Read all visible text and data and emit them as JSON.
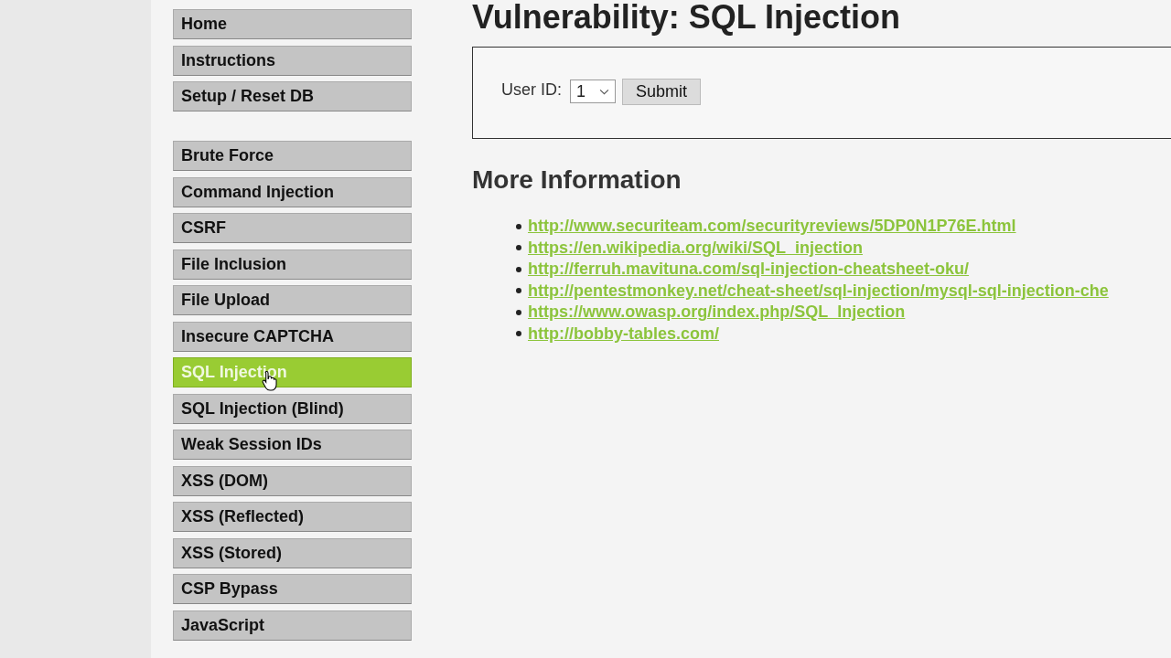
{
  "menu": {
    "groups": [
      {
        "items": [
          {
            "label": "Home",
            "selected": false
          },
          {
            "label": "Instructions",
            "selected": false
          },
          {
            "label": "Setup / Reset DB",
            "selected": false
          }
        ]
      },
      {
        "items": [
          {
            "label": "Brute Force",
            "selected": false
          },
          {
            "label": "Command Injection",
            "selected": false
          },
          {
            "label": "CSRF",
            "selected": false
          },
          {
            "label": "File Inclusion",
            "selected": false
          },
          {
            "label": "File Upload",
            "selected": false
          },
          {
            "label": "Insecure CAPTCHA",
            "selected": false
          },
          {
            "label": "SQL Injection",
            "selected": true
          },
          {
            "label": "SQL Injection (Blind)",
            "selected": false
          },
          {
            "label": "Weak Session IDs",
            "selected": false
          },
          {
            "label": "XSS (DOM)",
            "selected": false
          },
          {
            "label": "XSS (Reflected)",
            "selected": false
          },
          {
            "label": "XSS (Stored)",
            "selected": false
          },
          {
            "label": "CSP Bypass",
            "selected": false
          },
          {
            "label": "JavaScript",
            "selected": false
          }
        ]
      }
    ]
  },
  "main": {
    "title": "Vulnerability: SQL Injection",
    "form": {
      "label": "User ID:",
      "select_value": "1",
      "button": "Submit"
    },
    "more_info": {
      "heading": "More Information",
      "links": [
        "http://www.securiteam.com/securityreviews/5DP0N1P76E.html",
        "https://en.wikipedia.org/wiki/SQL_injection",
        "http://ferruh.mavituna.com/sql-injection-cheatsheet-oku/",
        "http://pentestmonkey.net/cheat-sheet/sql-injection/mysql-sql-injection-che",
        "https://www.owasp.org/index.php/SQL_Injection",
        "http://bobby-tables.com/"
      ]
    }
  }
}
